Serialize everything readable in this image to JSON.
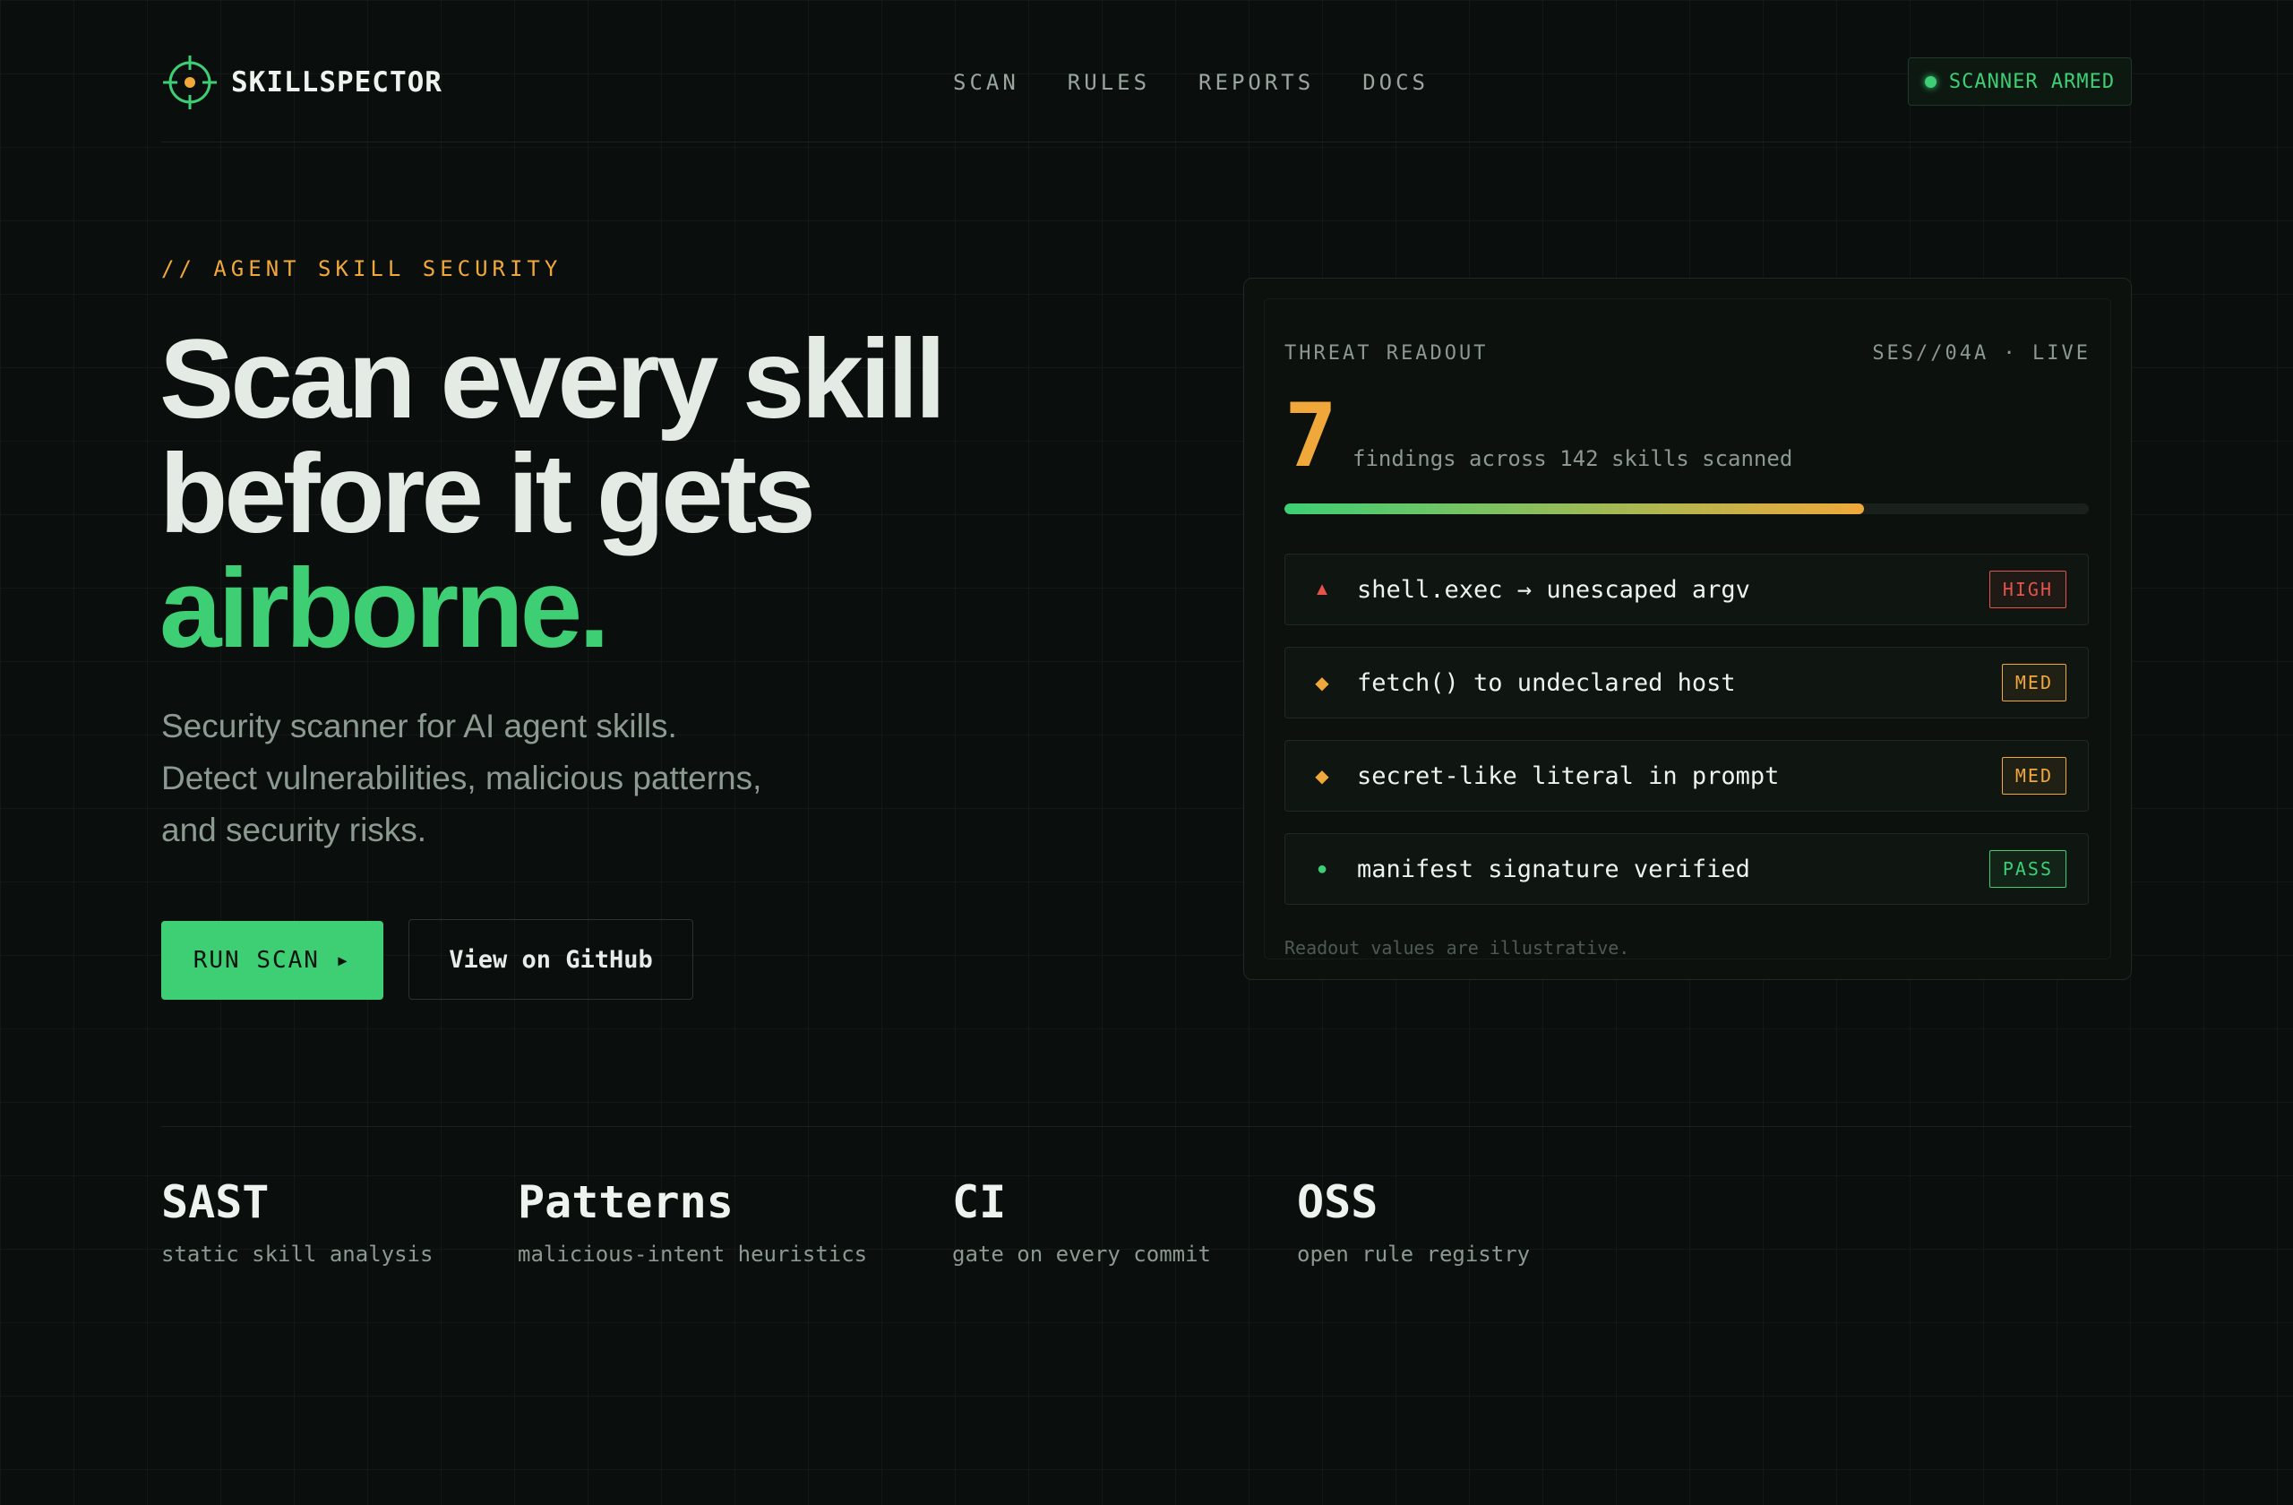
{
  "header": {
    "logo_text": "SKILLSPECTOR",
    "nav": [
      "SCAN",
      "RULES",
      "REPORTS",
      "DOCS"
    ],
    "status": "SCANNER ARMED"
  },
  "hero": {
    "eyebrow": "// AGENT SKILL SECURITY",
    "headline_line1": "Scan every skill",
    "headline_line2": "before it gets",
    "headline_accent": "airborne.",
    "subtitle": "Security scanner for AI agent skills. Detect vulnerabilities, malicious patterns, and security risks.",
    "primary_button": "RUN SCAN ▸",
    "secondary_button": "View on GitHub"
  },
  "readout": {
    "title": "THREAT READOUT",
    "session": "SES//04A · LIVE",
    "count": "7",
    "caption": "findings across 142 skills scanned",
    "progress": 0.72,
    "findings": [
      {
        "icon": "warning-triangle-icon",
        "glyph": "▲",
        "text": "shell.exec → unescaped argv",
        "badge": "HIGH",
        "color": "#e5534b"
      },
      {
        "icon": "diamond-icon",
        "glyph": "◆",
        "text": "fetch() to undeclared host",
        "badge": "MED",
        "color": "#f0a83a"
      },
      {
        "icon": "diamond-icon",
        "glyph": "◆",
        "text": "secret-like literal in prompt",
        "badge": "MED",
        "color": "#f0a83a"
      },
      {
        "icon": "dot-icon",
        "glyph": "●",
        "text": "manifest signature verified",
        "badge": "PASS",
        "color": "#3ecf75"
      }
    ],
    "note": "Readout values are illustrative."
  },
  "stats": [
    {
      "title": "SAST",
      "desc": "static skill analysis"
    },
    {
      "title": "Patterns",
      "desc": "malicious-intent heuristics"
    },
    {
      "title": "CI",
      "desc": "gate on every commit"
    },
    {
      "title": "OSS",
      "desc": "open rule registry"
    }
  ],
  "colors": {
    "accent": "#3ecf75",
    "warning": "#f0a83a",
    "danger": "#e5534b",
    "background": "#0a0e0c"
  }
}
